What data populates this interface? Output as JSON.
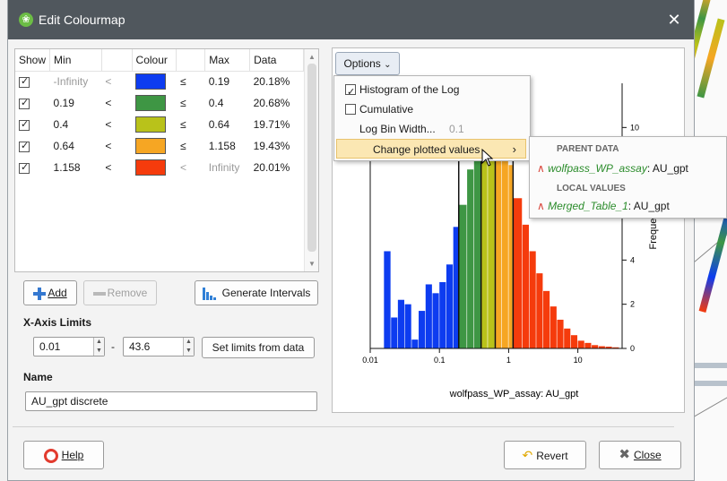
{
  "window": {
    "title": "Edit Colourmap",
    "close_glyph": "✕"
  },
  "table": {
    "columns": [
      "Show",
      "Min",
      "",
      "Colour",
      "",
      "Max",
      "Data"
    ],
    "rows": [
      {
        "show": true,
        "min": "-Infinity",
        "op1": "<",
        "colour": "#0d3cf0",
        "op2": "≤",
        "max": "0.19",
        "data": "20.18%"
      },
      {
        "show": true,
        "min": "0.19",
        "op1": "<",
        "colour": "#3e9644",
        "op2": "≤",
        "max": "0.4",
        "data": "20.68%"
      },
      {
        "show": true,
        "min": "0.4",
        "op1": "<",
        "colour": "#b9c21a",
        "op2": "≤",
        "max": "0.64",
        "data": "19.71%"
      },
      {
        "show": true,
        "min": "0.64",
        "op1": "<",
        "colour": "#f6a623",
        "op2": "≤",
        "max": "1.158",
        "data": "19.43%"
      },
      {
        "show": true,
        "min": "1.158",
        "op1": "<",
        "colour": "#f53b0c",
        "op2": "<",
        "max": "Infinity",
        "data": "20.01%"
      }
    ]
  },
  "buttons": {
    "add": "Add",
    "remove": "Remove",
    "generate_intervals": "Generate Intervals",
    "set_limits": "Set limits from data",
    "help": "Help",
    "revert": "Revert",
    "close": "Close"
  },
  "xaxis_limits": {
    "label": "X-Axis Limits",
    "min": "0.01",
    "separator": "-",
    "max": "43.6"
  },
  "name": {
    "label": "Name",
    "value": "AU_gpt discrete"
  },
  "options_menu": {
    "button_label": "Options",
    "items": [
      {
        "label": "Histogram of the Log",
        "checked": true
      },
      {
        "label": "Cumulative",
        "checked": false
      },
      {
        "label": "Log Bin Width...",
        "value": "0.1"
      },
      {
        "label": "Change plotted values",
        "highlighted": true
      }
    ]
  },
  "submenu": {
    "parent_header": "PARENT DATA",
    "parent_source": "wolfpass_WP_assay",
    "parent_value": ": AU_gpt",
    "local_header": "LOCAL VALUES",
    "local_source": "Merged_Table_1",
    "local_value": ": AU_gpt"
  },
  "colors": {
    "accent": "#3478d0",
    "menu_highlight": "#fbe7b3"
  },
  "chart_data": {
    "type": "bar",
    "xscale": "log",
    "xlabel": "wolfpass_WP_assay: AU_gpt",
    "ylabel": "Frequency",
    "ylabel_visible_text": "Frequen",
    "xticks": [
      "0.01",
      "0.1",
      "1",
      "10"
    ],
    "yticks": [
      "0",
      "2",
      "4",
      "10"
    ],
    "xlim": [
      0.01,
      43.6
    ],
    "ylim": [
      0,
      12
    ],
    "boundaries": [
      0.19,
      0.4,
      0.64,
      1.158
    ],
    "bins": [
      {
        "x0": 0.0158,
        "x1": 0.02,
        "value": 4.4,
        "color": "#0d3cf0"
      },
      {
        "x0": 0.02,
        "x1": 0.0251,
        "value": 1.4,
        "color": "#0d3cf0"
      },
      {
        "x0": 0.0251,
        "x1": 0.0316,
        "value": 2.2,
        "color": "#0d3cf0"
      },
      {
        "x0": 0.0316,
        "x1": 0.0398,
        "value": 2.0,
        "color": "#0d3cf0"
      },
      {
        "x0": 0.0398,
        "x1": 0.0501,
        "value": 0.4,
        "color": "#0d3cf0"
      },
      {
        "x0": 0.0501,
        "x1": 0.0631,
        "value": 1.7,
        "color": "#0d3cf0"
      },
      {
        "x0": 0.0631,
        "x1": 0.0794,
        "value": 2.9,
        "color": "#0d3cf0"
      },
      {
        "x0": 0.0794,
        "x1": 0.1,
        "value": 2.5,
        "color": "#0d3cf0"
      },
      {
        "x0": 0.1,
        "x1": 0.1259,
        "value": 3.0,
        "color": "#0d3cf0"
      },
      {
        "x0": 0.1259,
        "x1": 0.1585,
        "value": 3.8,
        "color": "#0d3cf0"
      },
      {
        "x0": 0.1585,
        "x1": 0.19,
        "value": 5.5,
        "color": "#0d3cf0"
      },
      {
        "x0": 0.19,
        "x1": 0.2512,
        "value": 6.5,
        "color": "#3e9644"
      },
      {
        "x0": 0.2512,
        "x1": 0.3162,
        "value": 8.1,
        "color": "#3e9644"
      },
      {
        "x0": 0.3162,
        "x1": 0.4,
        "value": 10.0,
        "color": "#3e9644"
      },
      {
        "x0": 0.4,
        "x1": 0.5012,
        "value": 10.9,
        "color": "#b9c21a"
      },
      {
        "x0": 0.5012,
        "x1": 0.64,
        "value": 11.2,
        "color": "#b9c21a"
      },
      {
        "x0": 0.64,
        "x1": 0.7943,
        "value": 10.7,
        "color": "#f6a623"
      },
      {
        "x0": 0.7943,
        "x1": 1.0,
        "value": 9.7,
        "color": "#f6a623"
      },
      {
        "x0": 1.0,
        "x1": 1.158,
        "value": 8.3,
        "color": "#f6a623"
      },
      {
        "x0": 1.158,
        "x1": 1.585,
        "value": 6.8,
        "color": "#f53b0c"
      },
      {
        "x0": 1.585,
        "x1": 1.995,
        "value": 5.6,
        "color": "#f53b0c"
      },
      {
        "x0": 1.995,
        "x1": 2.512,
        "value": 4.4,
        "color": "#f53b0c"
      },
      {
        "x0": 2.512,
        "x1": 3.162,
        "value": 3.4,
        "color": "#f53b0c"
      },
      {
        "x0": 3.162,
        "x1": 3.981,
        "value": 2.6,
        "color": "#f53b0c"
      },
      {
        "x0": 3.981,
        "x1": 5.012,
        "value": 1.9,
        "color": "#f53b0c"
      },
      {
        "x0": 5.012,
        "x1": 6.31,
        "value": 1.3,
        "color": "#f53b0c"
      },
      {
        "x0": 6.31,
        "x1": 7.943,
        "value": 0.9,
        "color": "#f53b0c"
      },
      {
        "x0": 7.943,
        "x1": 10.0,
        "value": 0.6,
        "color": "#f53b0c"
      },
      {
        "x0": 10.0,
        "x1": 12.59,
        "value": 0.35,
        "color": "#f53b0c"
      },
      {
        "x0": 12.59,
        "x1": 15.85,
        "value": 0.25,
        "color": "#f53b0c"
      },
      {
        "x0": 15.85,
        "x1": 19.95,
        "value": 0.15,
        "color": "#f53b0c"
      },
      {
        "x0": 19.95,
        "x1": 25.12,
        "value": 0.1,
        "color": "#f53b0c"
      },
      {
        "x0": 25.12,
        "x1": 31.62,
        "value": 0.08,
        "color": "#f53b0c"
      },
      {
        "x0": 31.62,
        "x1": 39.81,
        "value": 0.05,
        "color": "#f53b0c"
      }
    ]
  }
}
